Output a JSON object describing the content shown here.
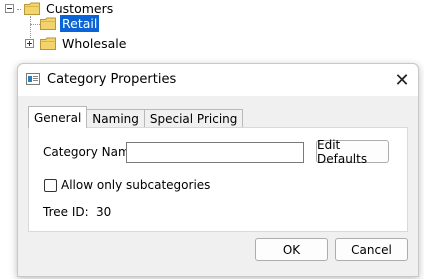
{
  "tree": {
    "root": {
      "label": "Customers",
      "expander": "minus"
    },
    "children": [
      {
        "label": "Retail",
        "selected": true
      },
      {
        "label": "Wholesale",
        "expander": "plus"
      }
    ]
  },
  "dialog": {
    "title": "Category Properties",
    "close_icon": "close-icon",
    "tabs": [
      {
        "label": "General",
        "active": true
      },
      {
        "label": "Naming"
      },
      {
        "label": "Special Pricing"
      }
    ],
    "general": {
      "category_name_label": "Category Name:",
      "category_name_value": "",
      "edit_defaults_label": "Edit Defaults",
      "allow_subcategories_label": "Allow only subcategories",
      "allow_subcategories_checked": false,
      "tree_id_label": "Tree ID:",
      "tree_id_value": "30"
    },
    "ok_label": "OK",
    "cancel_label": "Cancel"
  }
}
